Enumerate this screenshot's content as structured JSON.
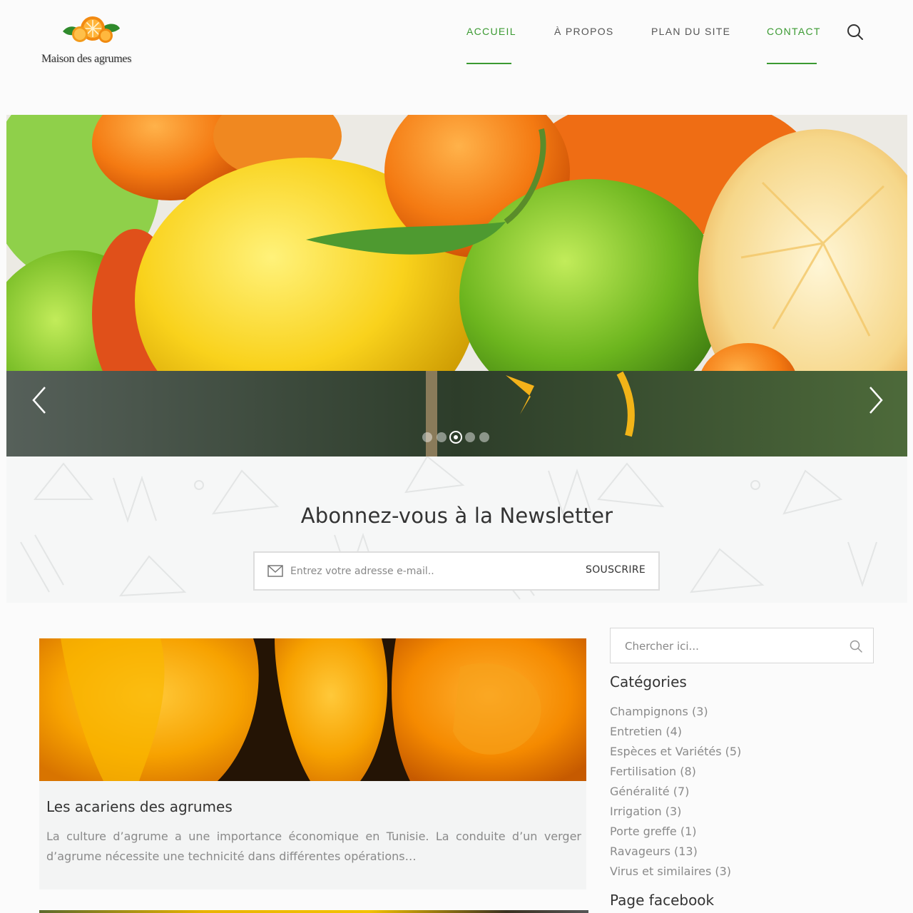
{
  "header": {
    "logo_text": "Maison des agrumes",
    "nav": [
      {
        "label": "ACCUEIL",
        "active": true
      },
      {
        "label": "À PROPOS",
        "active": false
      },
      {
        "label": "PLAN DU SITE",
        "active": false
      },
      {
        "label": "CONTACT",
        "active": true
      }
    ],
    "search_icon": "search-icon"
  },
  "slider": {
    "prev_icon": "chevron-left-icon",
    "next_icon": "chevron-right-icon",
    "slide_count": 5,
    "current_slide": 3
  },
  "newsletter": {
    "title": "Abonnez-vous à la Newsletter",
    "placeholder": "Entrez votre adresse e-mail..",
    "button": "SOUSCRIRE",
    "icon": "envelope-icon"
  },
  "posts": [
    {
      "title": "Les acariens des agrumes",
      "excerpt": "La culture d’agrume a une importance économique en Tunisie. La conduite d’un verger d’agrume nécessite une technicité dans  différentes opérations…"
    }
  ],
  "sidebar": {
    "search_placeholder": "Chercher ici...",
    "categories_title": "Catégories",
    "categories": [
      {
        "label": "Champignons (3)"
      },
      {
        "label": "Entretien (4)"
      },
      {
        "label": "Espèces et Variétés (5)"
      },
      {
        "label": "Fertilisation (8)"
      },
      {
        "label": "Généralité (7)"
      },
      {
        "label": "Irrigation (3)"
      },
      {
        "label": "Porte greffe (1)"
      },
      {
        "label": "Ravageurs (13)"
      },
      {
        "label": "Virus et similaires (3)"
      }
    ],
    "facebook_title": "Page facebook"
  },
  "colors": {
    "accent": "#3b9a32",
    "text": "#333333",
    "muted": "#8a8a8a"
  }
}
